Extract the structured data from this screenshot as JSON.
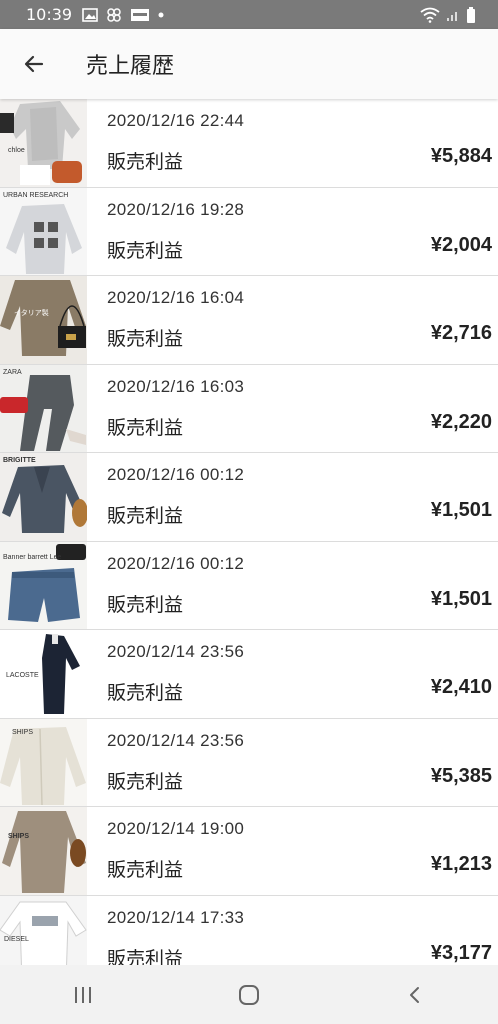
{
  "status_bar": {
    "time": "10:39"
  },
  "header": {
    "title": "売上履歴"
  },
  "rows": [
    {
      "brand": "chloe",
      "date": "2020/12/16 22:44",
      "label": "販売利益",
      "amount": "¥5,884"
    },
    {
      "brand": "URBAN RESEARCH",
      "date": "2020/12/16 19:28",
      "label": "販売利益",
      "amount": "¥2,004"
    },
    {
      "brand": "イタリア製",
      "date": "2020/12/16 16:04",
      "label": "販売利益",
      "amount": "¥2,716"
    },
    {
      "brand": "ZARA",
      "date": "2020/12/16 16:03",
      "label": "販売利益",
      "amount": "¥2,220"
    },
    {
      "brand": "BRIGITTE",
      "date": "2020/12/16 00:12",
      "label": "販売利益",
      "amount": "¥1,501"
    },
    {
      "brand": "Banner barrett Lee",
      "date": "2020/12/16 00:12",
      "label": "販売利益",
      "amount": "¥1,501"
    },
    {
      "brand": "LACOSTE",
      "date": "2020/12/14 23:56",
      "label": "販売利益",
      "amount": "¥2,410"
    },
    {
      "brand": "SHIPS",
      "date": "2020/12/14 23:56",
      "label": "販売利益",
      "amount": "¥5,385"
    },
    {
      "brand": "SHIPS",
      "date": "2020/12/14 19:00",
      "label": "販売利益",
      "amount": "¥1,213"
    },
    {
      "brand": "DIESEL",
      "date": "2020/12/14 17:33",
      "label": "販売利益",
      "amount": "¥3,177"
    }
  ],
  "icons": {
    "back": "arrow-left-icon",
    "recents": "recent-apps-icon",
    "home": "home-icon",
    "nav_back": "nav-back-icon"
  },
  "colors": {
    "status_bar": "#7a7a7a",
    "app_bar": "#fafafa",
    "nav_bar": "#f2f2f2",
    "divider": "#dcdcdc"
  }
}
